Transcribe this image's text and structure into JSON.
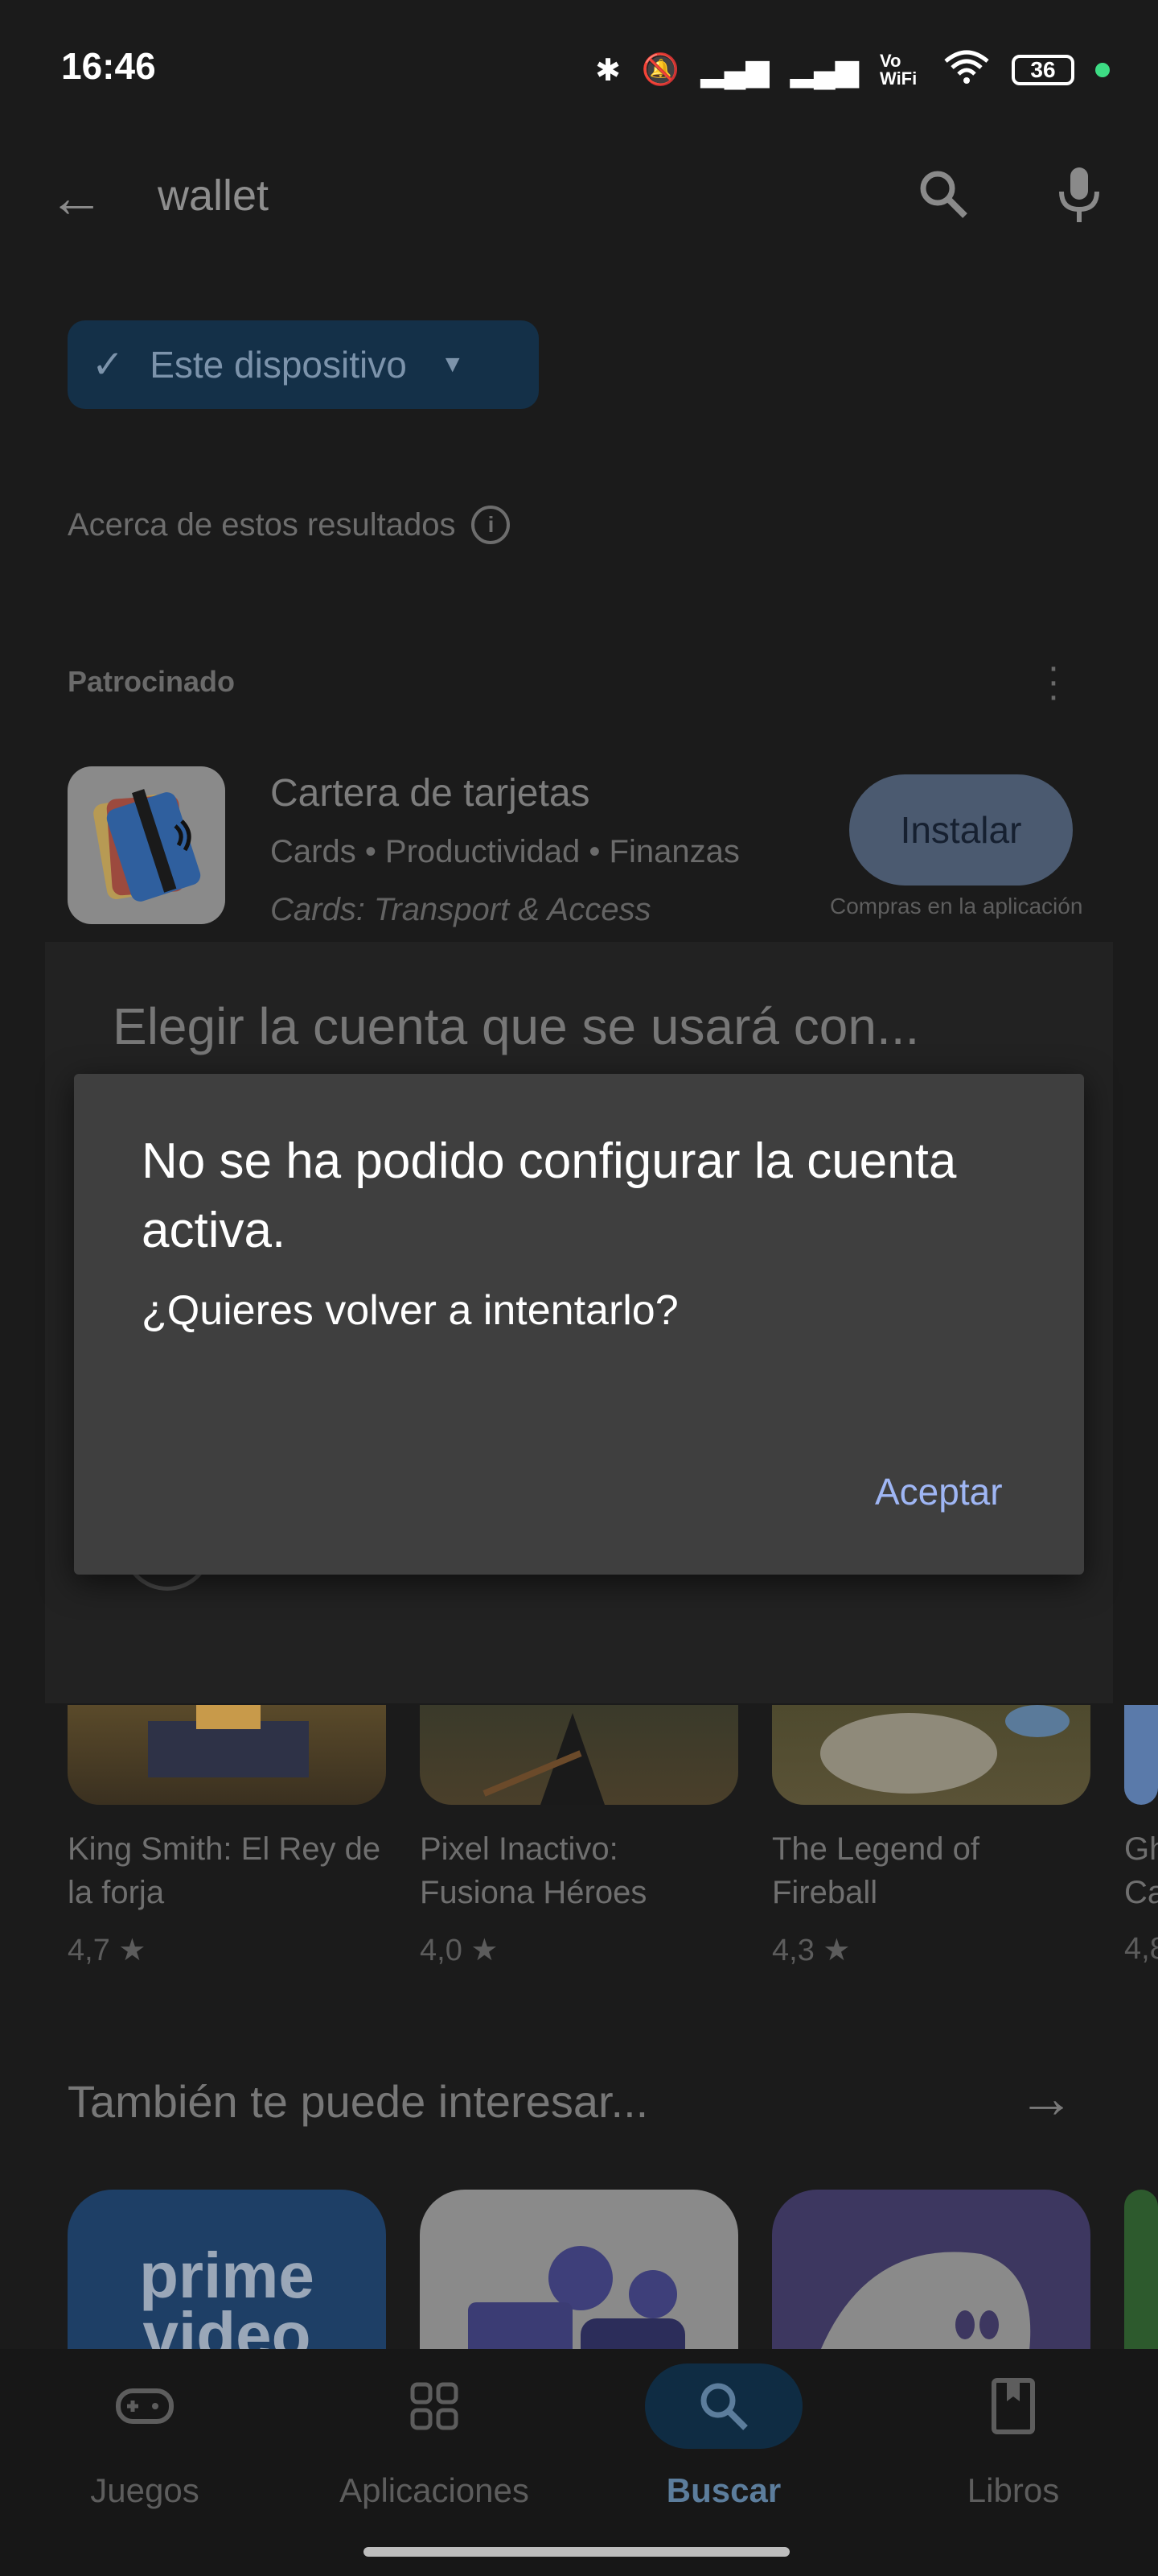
{
  "status_bar": {
    "time": "16:46",
    "battery": "36",
    "vowifi": "Vo WiFi"
  },
  "search": {
    "query": "wallet"
  },
  "filter_chip": {
    "label": "Este dispositivo"
  },
  "about_results": "Acerca de estos resultados",
  "sponsored": {
    "label": "Patrocinado",
    "app_name": "Cartera de tarjetas",
    "meta": "Cards • Productividad • Finanzas",
    "subtitle": "Cards: Transport & Access",
    "install_label": "Instalar",
    "in_app_note": "Compras en la aplicación"
  },
  "account_sheet": {
    "title": "Elegir la cuenta que se usará con..."
  },
  "games": [
    {
      "title": "King Smith: El Rey de la forja",
      "rating": "4,7 ★"
    },
    {
      "title": "Pixel Inactivo: Fusiona Héroes",
      "rating": "4,0 ★"
    },
    {
      "title": "The Legend of Fireball",
      "rating": "4,3 ★"
    },
    {
      "title": "Gh Ca",
      "rating": "4,8"
    }
  ],
  "also_interested": {
    "title": "También te puede interesar..."
  },
  "tiles": {
    "prime": "prime video"
  },
  "dialog": {
    "title": "No se ha podido configurar la cuenta activa.",
    "message": "¿Quieres volver a intentarlo?",
    "accept": "Aceptar"
  },
  "bottom_nav": [
    {
      "label": "Juegos",
      "icon": "gamepad-icon"
    },
    {
      "label": "Aplicaciones",
      "icon": "apps-icon"
    },
    {
      "label": "Buscar",
      "icon": "search-icon",
      "active": true
    },
    {
      "label": "Libros",
      "icon": "book-icon"
    }
  ]
}
